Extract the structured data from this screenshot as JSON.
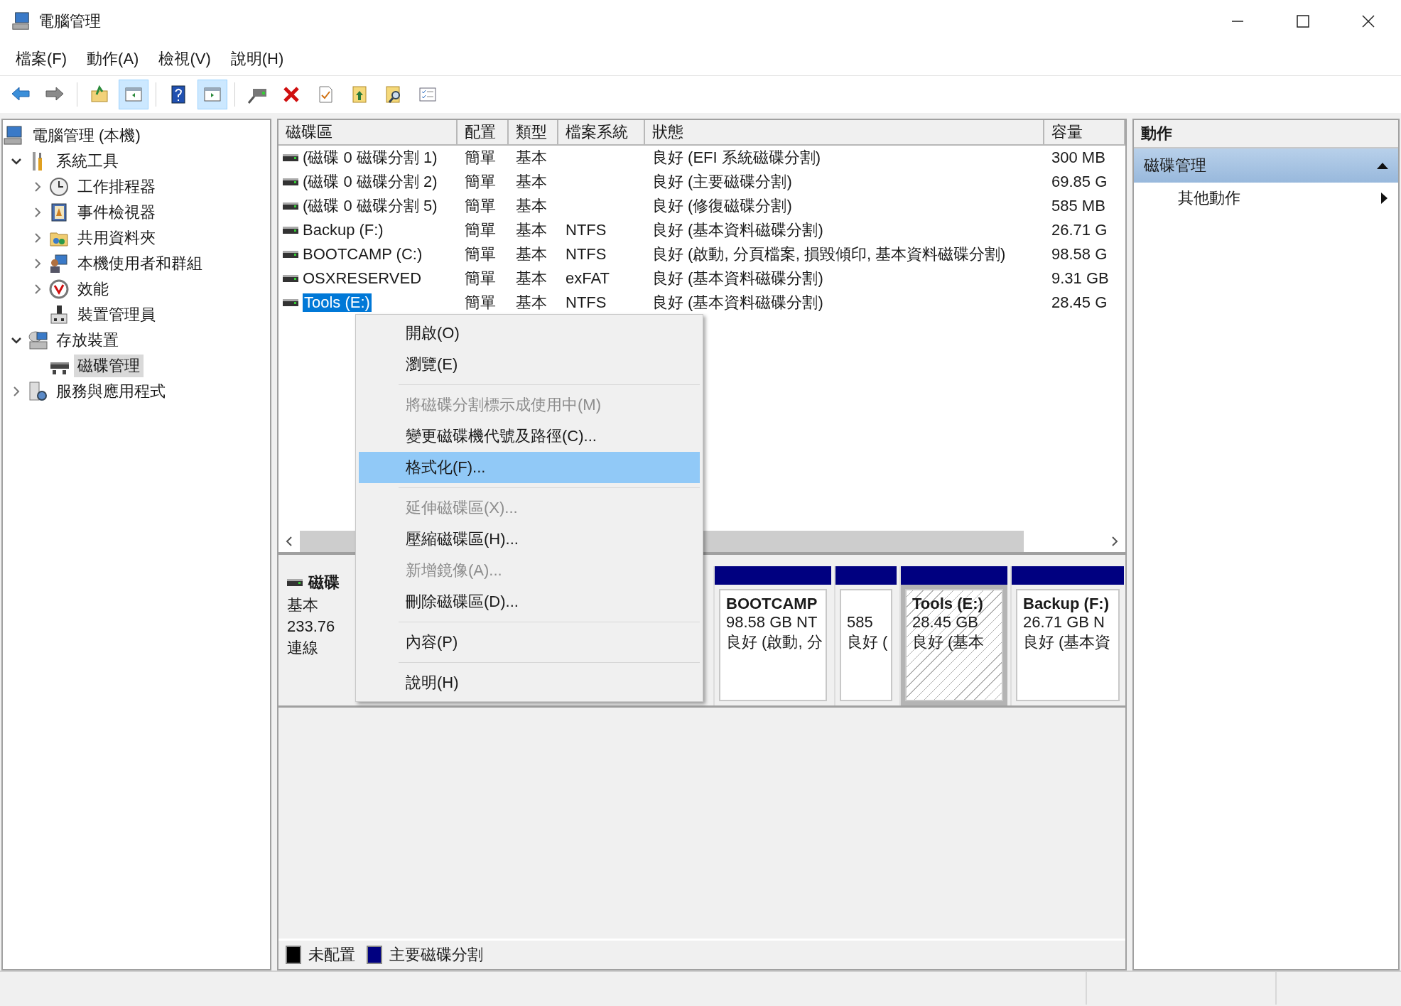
{
  "window": {
    "title": "電腦管理"
  },
  "menu_bar": [
    "檔案(F)",
    "動作(A)",
    "檢視(V)",
    "說明(H)"
  ],
  "toolbar": [
    {
      "kind": "back",
      "pressed": false
    },
    {
      "kind": "forward",
      "pressed": false
    },
    {
      "kind": "sep"
    },
    {
      "kind": "up-folder",
      "pressed": false
    },
    {
      "kind": "tree-pane",
      "pressed": true
    },
    {
      "kind": "sep"
    },
    {
      "kind": "help",
      "pressed": false
    },
    {
      "kind": "action-pane",
      "pressed": true
    },
    {
      "kind": "sep"
    },
    {
      "kind": "connect",
      "pressed": false
    },
    {
      "kind": "delete",
      "pressed": false
    },
    {
      "kind": "properties",
      "pressed": false
    },
    {
      "kind": "export",
      "pressed": false
    },
    {
      "kind": "find",
      "pressed": false
    },
    {
      "kind": "checklist",
      "pressed": false
    }
  ],
  "tree": {
    "label": "電腦管理 (本機)",
    "kind": "computer",
    "selected": false,
    "children": [
      {
        "label": "系統工具",
        "kind": "tools",
        "expanded": true,
        "selected": false,
        "children": [
          {
            "label": "工作排程器",
            "kind": "clock",
            "expanded": false,
            "selected": false
          },
          {
            "label": "事件檢視器",
            "kind": "event",
            "expanded": false,
            "selected": false
          },
          {
            "label": "共用資料夾",
            "kind": "folder",
            "expanded": false,
            "selected": false
          },
          {
            "label": "本機使用者和群組",
            "kind": "users",
            "expanded": false,
            "selected": false
          },
          {
            "label": "效能",
            "kind": "perf",
            "expanded": false,
            "selected": false
          },
          {
            "label": "裝置管理員",
            "kind": "device",
            "selected": false
          }
        ]
      },
      {
        "label": "存放裝置",
        "kind": "storage",
        "expanded": true,
        "selected": false,
        "children": [
          {
            "label": "磁碟管理",
            "kind": "disk",
            "selected": true
          }
        ]
      },
      {
        "label": "服務與應用程式",
        "kind": "services",
        "expanded": false,
        "selected": false
      }
    ]
  },
  "table": {
    "columns": [
      "磁碟區",
      "配置",
      "類型",
      "檔案系統",
      "狀態",
      "容量"
    ],
    "rows": [
      {
        "cells": [
          "(磁碟 0 磁碟分割 1)",
          "簡單",
          "基本",
          "",
          "良好 (EFI 系統磁碟分割)",
          "300 MB"
        ],
        "selected": false
      },
      {
        "cells": [
          "(磁碟 0 磁碟分割 2)",
          "簡單",
          "基本",
          "",
          "良好 (主要磁碟分割)",
          "69.85 G"
        ],
        "selected": false
      },
      {
        "cells": [
          "(磁碟 0 磁碟分割 5)",
          "簡單",
          "基本",
          "",
          "良好 (修復磁碟分割)",
          "585 MB"
        ],
        "selected": false
      },
      {
        "cells": [
          "Backup (F:)",
          "簡單",
          "基本",
          "NTFS",
          "良好 (基本資料磁碟分割)",
          "26.71 G"
        ],
        "selected": false
      },
      {
        "cells": [
          "BOOTCAMP (C:)",
          "簡單",
          "基本",
          "NTFS",
          "良好 (啟動, 分頁檔案, 損毀傾印, 基本資料磁碟分割)",
          "98.58 G"
        ],
        "selected": false
      },
      {
        "cells": [
          "OSXRESERVED",
          "簡單",
          "基本",
          "exFAT",
          "良好 (基本資料磁碟分割)",
          "9.31 GB"
        ],
        "selected": false
      },
      {
        "cells": [
          "Tools (E:)",
          "簡單",
          "基本",
          "NTFS",
          "良好 (基本資料磁碟分割)",
          "28.45 G"
        ],
        "selected": true
      }
    ]
  },
  "context_menu": [
    {
      "kind": "item",
      "label": "開啟(O)",
      "disabled": false,
      "selected": false
    },
    {
      "kind": "item",
      "label": "瀏覽(E)",
      "disabled": false,
      "selected": false
    },
    {
      "kind": "separator"
    },
    {
      "kind": "item",
      "label": "將磁碟分割標示成使用中(M)",
      "disabled": true,
      "selected": false
    },
    {
      "kind": "item",
      "label": "變更磁碟機代號及路徑(C)...",
      "disabled": false,
      "selected": false
    },
    {
      "kind": "item",
      "label": "格式化(F)...",
      "disabled": false,
      "selected": true
    },
    {
      "kind": "separator"
    },
    {
      "kind": "item",
      "label": "延伸磁碟區(X)...",
      "disabled": true,
      "selected": false
    },
    {
      "kind": "item",
      "label": "壓縮磁碟區(H)...",
      "disabled": false,
      "selected": false
    },
    {
      "kind": "item",
      "label": "新增鏡像(A)...",
      "disabled": true,
      "selected": false
    },
    {
      "kind": "item",
      "label": "刪除磁碟區(D)...",
      "disabled": false,
      "selected": false
    },
    {
      "kind": "separator"
    },
    {
      "kind": "item",
      "label": "內容(P)",
      "disabled": false,
      "selected": false
    },
    {
      "kind": "separator"
    },
    {
      "kind": "item",
      "label": "說明(H)",
      "disabled": false,
      "selected": false
    }
  ],
  "disk": {
    "name": "磁碟",
    "type": "基本",
    "size": "233.76",
    "status": "連線",
    "partitions": [
      {
        "name": "BOOTCAMP",
        "size": "98.58 GB NT",
        "status": "良好 (啟動, 分",
        "selected": false
      },
      {
        "size": "585",
        "status": "良好 (",
        "selected": false
      },
      {
        "name": "Tools  (E:)",
        "size": "28.45 GB",
        "status": "良好 (基本",
        "selected": true
      },
      {
        "name": "Backup  (F:)",
        "size": "26.71 GB N",
        "status": "良好 (基本資",
        "selected": false
      }
    ]
  },
  "legend": [
    {
      "label": "未配置",
      "color": "#000000"
    },
    {
      "label": "主要磁碟分割",
      "color": "#000080"
    }
  ],
  "actions": {
    "title": "動作",
    "section": {
      "label": "磁碟管理",
      "expanded": true
    },
    "items": [
      "其他動作"
    ]
  }
}
